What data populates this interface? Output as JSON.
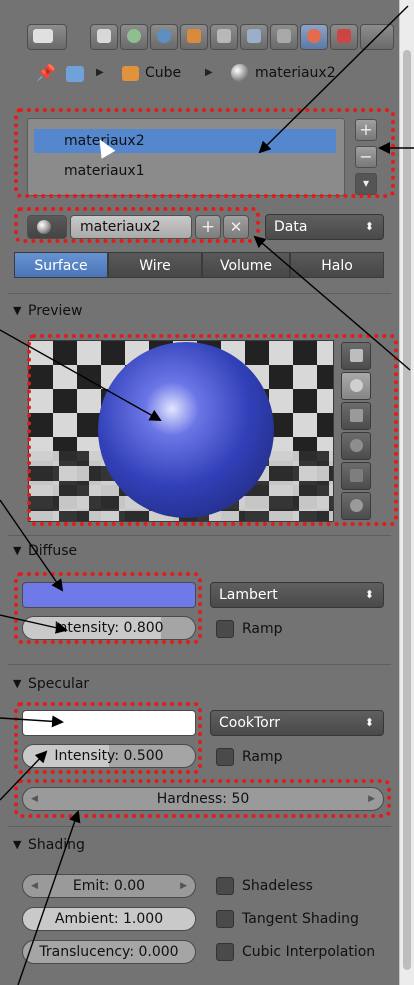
{
  "breadcrumb": {
    "object": "Cube",
    "material": "materiaux2"
  },
  "material_slots": {
    "items": [
      {
        "label": "materiaux2",
        "selected": true
      },
      {
        "label": "materiaux1",
        "selected": false
      }
    ],
    "add_symbol": "+",
    "remove_symbol": "−",
    "dropdown_symbol": "▾"
  },
  "datablock": {
    "name": "materiaux2",
    "add_symbol": "+",
    "remove_symbol": "✕",
    "link_value": "Data",
    "link_arrow": "⬍"
  },
  "type_tabs": [
    "Surface",
    "Wire",
    "Volume",
    "Halo"
  ],
  "preview": {
    "title": "Preview"
  },
  "diffuse": {
    "title": "Diffuse",
    "color": "#6f7ae8",
    "shader": "Lambert",
    "intensity_label": "Intensity: 0.800",
    "intensity": 0.8,
    "ramp_label": "Ramp"
  },
  "specular": {
    "title": "Specular",
    "color": "#ffffff",
    "shader": "CookTorr",
    "intensity_label": "Intensity: 0.500",
    "intensity": 0.5,
    "ramp_label": "Ramp",
    "hardness_label": "Hardness: 50"
  },
  "shading": {
    "title": "Shading",
    "emit_label": "Emit: 0.00",
    "ambient_label": "Ambient: 1.000",
    "ambient": 1.0,
    "translucency_label": "Translucency: 0.000",
    "translucency": 0.0,
    "checks": [
      "Shadeless",
      "Tangent Shading",
      "Cubic Interpolation"
    ]
  },
  "colors": {
    "accent": "#5487ce",
    "annotation": "#e41b1b",
    "panel": "#737373"
  },
  "icons": [
    "properties-editor-icon",
    "render-icon",
    "scene-icon",
    "world-icon",
    "object-icon",
    "constraints-icon",
    "modifiers-icon",
    "data-icon",
    "material-icon",
    "texture-icon",
    "pin-icon",
    "sphere-icon"
  ]
}
